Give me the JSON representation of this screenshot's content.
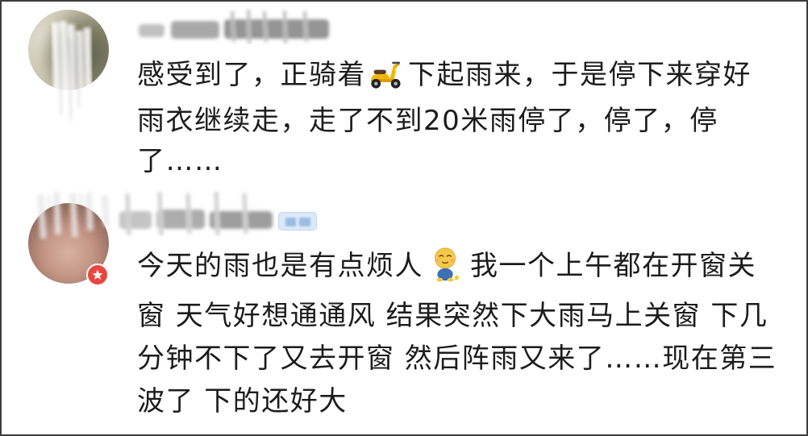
{
  "colors": {
    "text": "#1c1c1c",
    "background": "#ffffff",
    "frame": "#3d3d3d",
    "badge_red": "#e8473f",
    "badge_blue": "#dce9f8"
  },
  "comments": [
    {
      "line_1_start": "感受到了，正骑着",
      "emoji": "scooter-emoji-icon",
      "line_1_end": "下起雨来，于是停下来穿好",
      "line_2": "雨衣继续走，走了不到20米雨停了，停了，停",
      "line_3": "了……"
    },
    {
      "line_1_start": "今天的雨也是有点烦人",
      "emoji": "sitting-face-emoji-icon",
      "line_1_end": "我一个上午都在开窗关",
      "line_2": "窗 天气好想通通风 结果突然下大雨马上关窗 下几",
      "line_3": "分钟不下了又去开窗 然后阵雨又来了……现在第三",
      "line_4": "波了 下的还好大"
    }
  ]
}
